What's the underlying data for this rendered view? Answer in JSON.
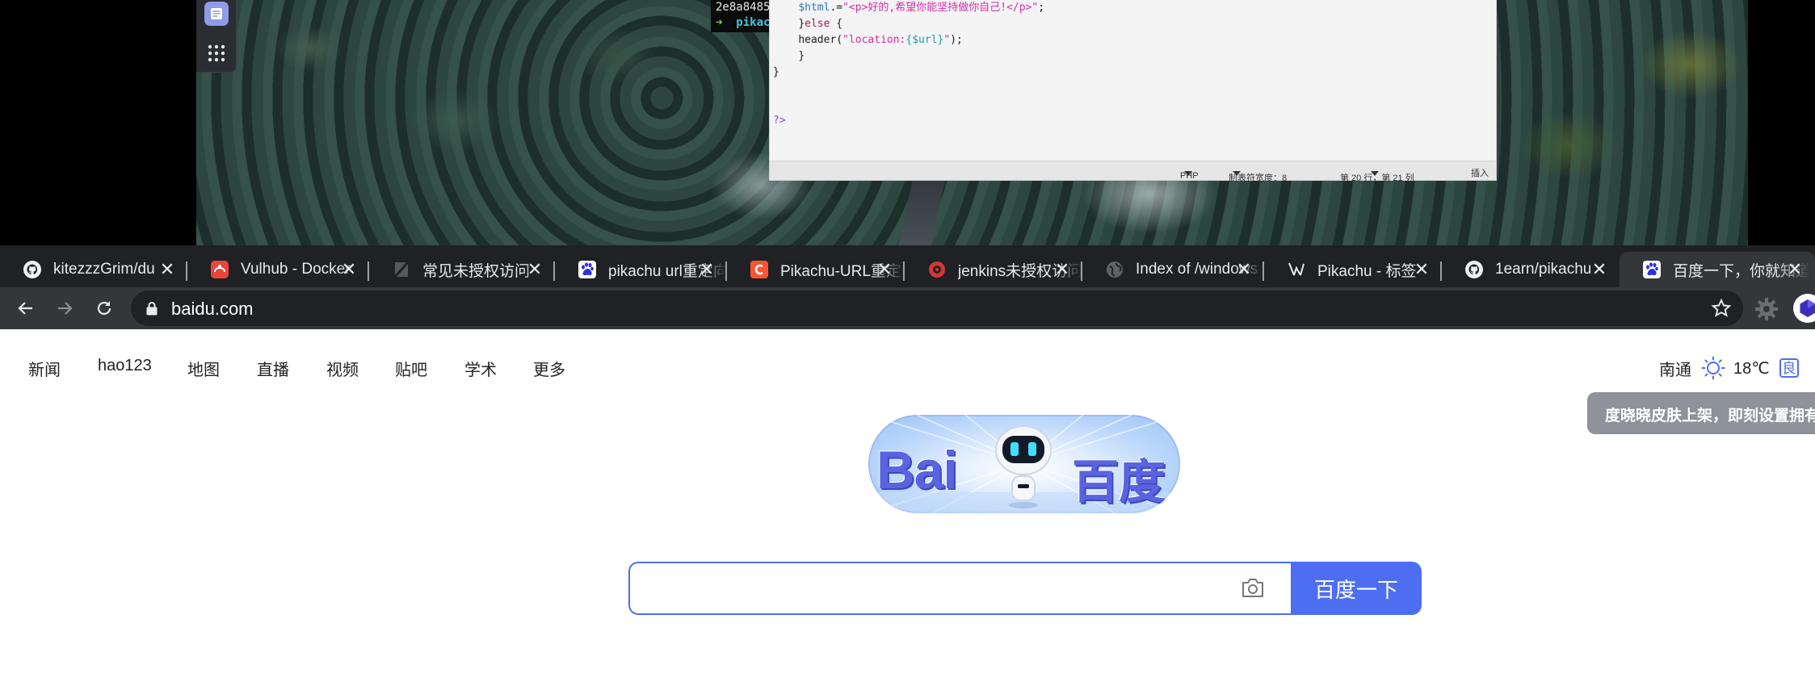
{
  "desktop": {
    "terminal": {
      "line1": "2e8a8485",
      "line2_prompt": "➜",
      "line2_path": "pikac"
    },
    "editor": {
      "code_lines": [
        {
          "indent": "    ",
          "parts": [
            [
              "var",
              "$html"
            ],
            [
              "plain",
              ".="
            ],
            [
              "str",
              "\"<p>好的,希望你能坚持做你自己!</p>\""
            ],
            [
              "plain",
              ";"
            ]
          ]
        },
        {
          "indent": "    ",
          "parts": [
            [
              "plain",
              "}"
            ],
            [
              "kw",
              "else"
            ],
            [
              "plain",
              " {"
            ]
          ]
        },
        {
          "indent": "    ",
          "parts": [
            [
              "plain",
              "header("
            ],
            [
              "str",
              "\"location:"
            ],
            [
              "tpl",
              "{$url}"
            ],
            [
              "str",
              "\""
            ],
            [
              "plain",
              ");"
            ]
          ]
        },
        {
          "indent": "    ",
          "parts": [
            [
              "plain",
              "}"
            ]
          ]
        },
        {
          "indent": "",
          "parts": [
            [
              "plain",
              "}"
            ]
          ]
        },
        {
          "indent": "",
          "parts": []
        },
        {
          "indent": "",
          "parts": []
        },
        {
          "indent": "",
          "parts": [
            [
              "php",
              "?>"
            ]
          ]
        }
      ],
      "status": {
        "language": "PHP",
        "tab_width": "制表符宽度：8",
        "position": "第 20 行，第 21 列",
        "mode": "插入"
      }
    }
  },
  "browser": {
    "tabs": [
      {
        "title": "kitezzzGrim/du",
        "icon": "github-icon"
      },
      {
        "title": "Vulhub - Docker",
        "icon": "vulhub-icon"
      },
      {
        "title": "常见未授权访问",
        "icon": "doc-icon"
      },
      {
        "title": "pikachu url重定向",
        "icon": "paw-icon"
      },
      {
        "title": "Pikachu-URL重定向",
        "icon": "csdn-icon"
      },
      {
        "title": "jenkins未授权访问",
        "icon": "jenkins-icon"
      },
      {
        "title": "Index of /windows",
        "icon": "globe-icon"
      },
      {
        "title": "Pikachu - 标签",
        "icon": "pikachu-icon"
      },
      {
        "title": "1earn/pikachu",
        "icon": "github-icon"
      },
      {
        "title": "百度一下，你就知道",
        "icon": "paw-icon"
      }
    ],
    "url": "baidu.com"
  },
  "baidu": {
    "nav": [
      "新闻",
      "hao123",
      "地图",
      "直播",
      "视频",
      "贴吧",
      "学术",
      "更多"
    ],
    "weather": {
      "city": "南通",
      "temp": "18℃",
      "air_quality": "良"
    },
    "tooltip": "度晓晓皮肤上架，即刻设置拥有",
    "logo": {
      "latin": "Bai",
      "chinese": "百度"
    },
    "search": {
      "placeholder": "",
      "button_label": "百度一下"
    }
  },
  "colors": {
    "brand_blue": "#4e6ef2",
    "tab_bar": "#202124",
    "toolbar": "#35363a"
  }
}
